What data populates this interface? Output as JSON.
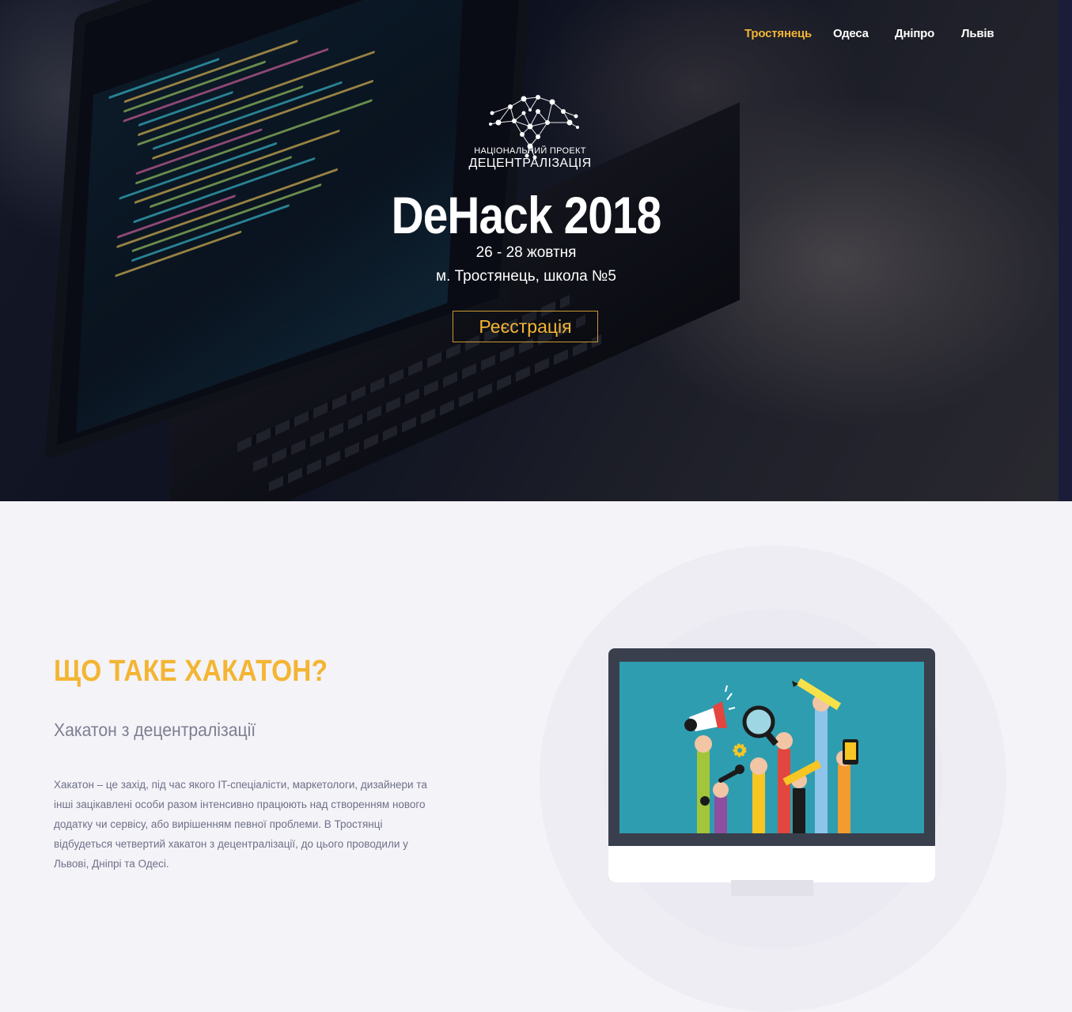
{
  "nav": {
    "items": [
      {
        "label": "Тростянець",
        "active": true
      },
      {
        "label": "Одеса",
        "active": false
      },
      {
        "label": "Дніпро",
        "active": false
      },
      {
        "label": "Львів",
        "active": false
      }
    ]
  },
  "logo": {
    "line1": "НАЦІОНАЛЬНИЙ ПРОЕКТ",
    "line2": "ДЕЦЕНТРАЛІЗАЦІЯ"
  },
  "hero": {
    "title": "DeHack 2018",
    "date": "26 - 28 жовтня",
    "place": "м. Тростянець, школа №5",
    "register_label": "Реєстрація"
  },
  "about": {
    "title": "ЩО ТАКЕ ХАКАТОН?",
    "subtitle": "Хакатон з децентралізації",
    "body": "Хакатон – це захід, під час якого IT-спеціалісти, маркетологи, дизайнери та інші зацікавлені особи разом інтенсивно працюють над створенням нового додатку чи сервісу, або вирішенням певної проблеми. В Тростянці відбудеться четвертий хакатон з децентралізації, до цього проводили у Львові, Дніпрі та Одесі."
  },
  "colors": {
    "accent": "#f3b533",
    "screen": "#2f9db0",
    "page_bg": "#f4f3f8"
  }
}
